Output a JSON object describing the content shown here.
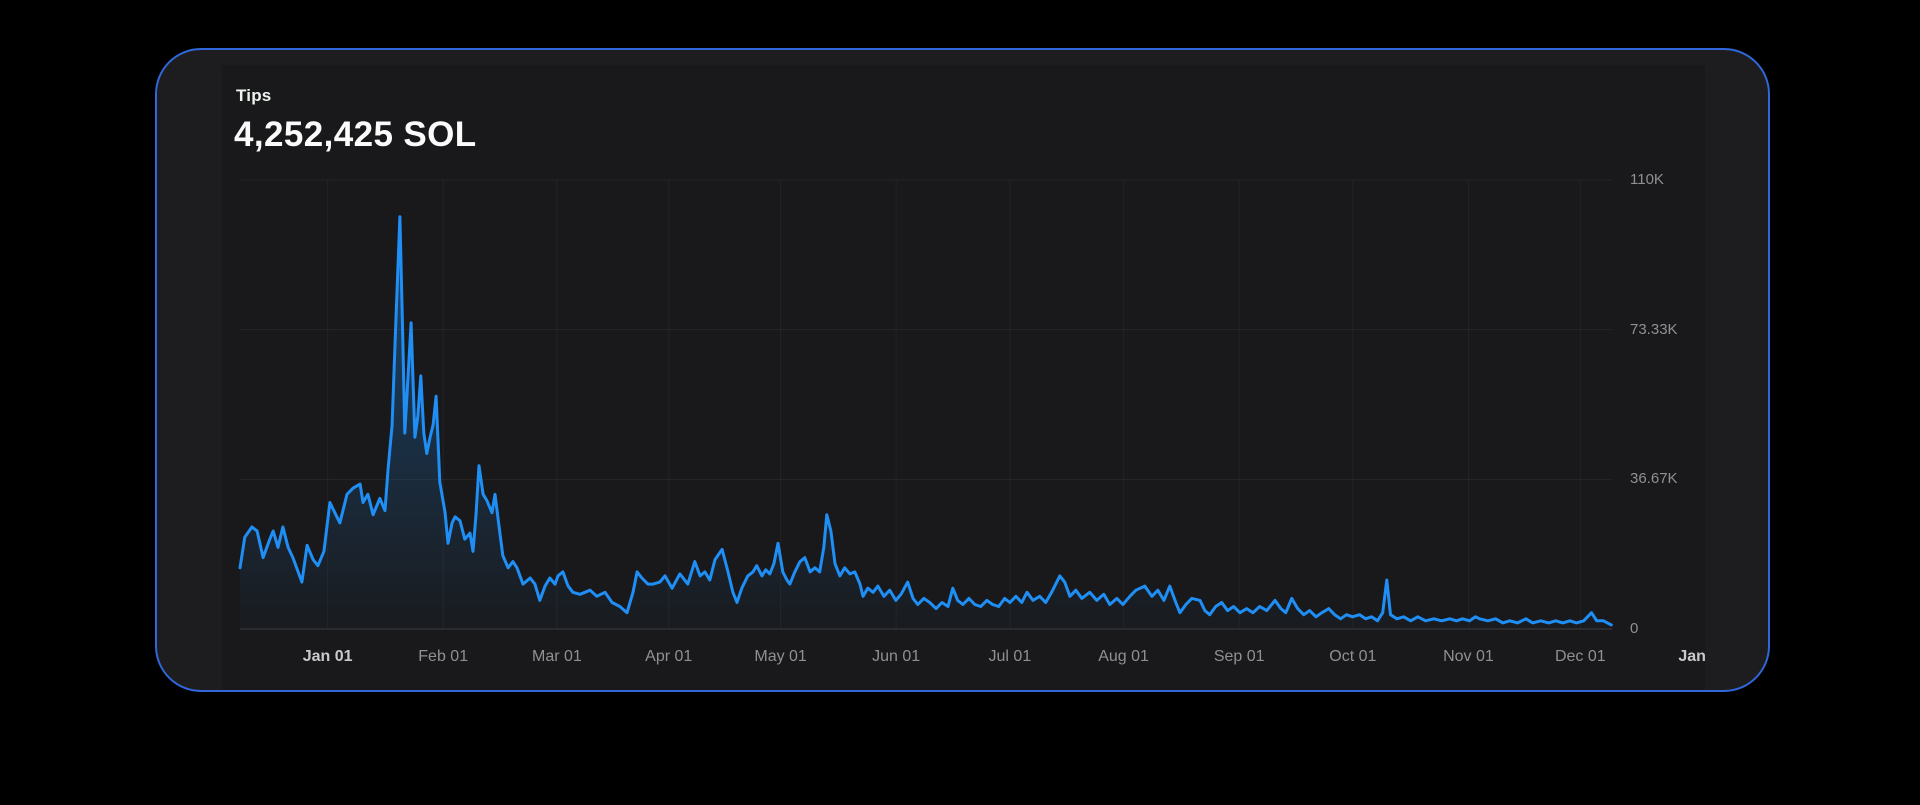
{
  "page": {
    "background_color": "#000000"
  },
  "card": {
    "border_color": "#3067da",
    "background": "#1d1d1f",
    "panel_background": "#19191b"
  },
  "header": {
    "title": "Tips",
    "value": "4,252,425 SOL"
  },
  "chart_data": {
    "type": "area",
    "title": "Tips",
    "total": "4,252,425 SOL",
    "unit": "SOL",
    "line_color": "#1f8ef5",
    "grid": true,
    "legend": null,
    "y_axis_position": "right",
    "ylim": [
      0,
      110000
    ],
    "y_ticks": [
      {
        "label": "0",
        "value": 0
      },
      {
        "label": "36.67K",
        "value": 36670
      },
      {
        "label": "73.33K",
        "value": 73330
      },
      {
        "label": "110K",
        "value": 110000
      }
    ],
    "x_unit": "days from series start (about Dec 08 of previous year)",
    "x_ticks": [
      {
        "label": "Jan 01",
        "d": 23.5,
        "emphasis": true
      },
      {
        "label": "Feb 01",
        "d": 54.5,
        "emphasis": false
      },
      {
        "label": "Mar 01",
        "d": 85.0,
        "emphasis": false
      },
      {
        "label": "Apr 01",
        "d": 115.0,
        "emphasis": false
      },
      {
        "label": "May 01",
        "d": 145.0,
        "emphasis": false
      },
      {
        "label": "Jun 01",
        "d": 176.0,
        "emphasis": false
      },
      {
        "label": "Jul 01",
        "d": 206.5,
        "emphasis": false
      },
      {
        "label": "Aug 01",
        "d": 237.0,
        "emphasis": false
      },
      {
        "label": "Sep 01",
        "d": 268.0,
        "emphasis": false
      },
      {
        "label": "Oct 01",
        "d": 298.5,
        "emphasis": false
      },
      {
        "label": "Nov 01",
        "d": 329.5,
        "emphasis": false
      },
      {
        "label": "Dec 01",
        "d": 359.5,
        "emphasis": false
      },
      {
        "label": "Jan",
        "d": 389.5,
        "emphasis": true
      }
    ],
    "points_value_unit": "thousand SOL per day",
    "points": [
      [
        0,
        15
      ],
      [
        1.3,
        22.5
      ],
      [
        3.2,
        25
      ],
      [
        4.6,
        24
      ],
      [
        6.2,
        17.5
      ],
      [
        8,
        22
      ],
      [
        8.9,
        24
      ],
      [
        10.2,
        20
      ],
      [
        11.5,
        25
      ],
      [
        12.9,
        20
      ],
      [
        14.2,
        17.5
      ],
      [
        16.6,
        11.5
      ],
      [
        18,
        20.5
      ],
      [
        19.6,
        17
      ],
      [
        20.9,
        15.5
      ],
      [
        22.5,
        19
      ],
      [
        24.1,
        31
      ],
      [
        25.7,
        28
      ],
      [
        26.8,
        26
      ],
      [
        28.7,
        33
      ],
      [
        30.3,
        34.5
      ],
      [
        32.2,
        35.5
      ],
      [
        33,
        31
      ],
      [
        34.3,
        33
      ],
      [
        35.7,
        28
      ],
      [
        37.5,
        32
      ],
      [
        38.9,
        29
      ],
      [
        39.7,
        39
      ],
      [
        40.8,
        50
      ],
      [
        41.8,
        75
      ],
      [
        42.9,
        101
      ],
      [
        43.7,
        70
      ],
      [
        44.2,
        48
      ],
      [
        45.9,
        75
      ],
      [
        46.9,
        47
      ],
      [
        47.7,
        52
      ],
      [
        48.5,
        62
      ],
      [
        49.3,
        48
      ],
      [
        50.1,
        43
      ],
      [
        51,
        47
      ],
      [
        51.8,
        50
      ],
      [
        52.6,
        57
      ],
      [
        53.6,
        36
      ],
      [
        55,
        28.5
      ],
      [
        55.8,
        21
      ],
      [
        56.9,
        26
      ],
      [
        57.7,
        27.5
      ],
      [
        59,
        26.5
      ],
      [
        60.3,
        22
      ],
      [
        61.7,
        23.5
      ],
      [
        62.5,
        19
      ],
      [
        63.3,
        28
      ],
      [
        64.1,
        40
      ],
      [
        65.2,
        33
      ],
      [
        66.2,
        31.5
      ],
      [
        67.6,
        28.5
      ],
      [
        68.4,
        33
      ],
      [
        69.7,
        23.5
      ],
      [
        70.5,
        18
      ],
      [
        71.9,
        15
      ],
      [
        73.2,
        16.5
      ],
      [
        74.3,
        15
      ],
      [
        75.9,
        11
      ],
      [
        77.8,
        12.5
      ],
      [
        79.1,
        11
      ],
      [
        80.4,
        7
      ],
      [
        81.8,
        10.5
      ],
      [
        83.1,
        12.5
      ],
      [
        84.5,
        11
      ],
      [
        85.3,
        13
      ],
      [
        86.6,
        14
      ],
      [
        88,
        10.5
      ],
      [
        89.3,
        9
      ],
      [
        91.2,
        8.5
      ],
      [
        93.9,
        9.5
      ],
      [
        95.7,
        8
      ],
      [
        97.9,
        9
      ],
      [
        99.8,
        6.5
      ],
      [
        101.9,
        5.5
      ],
      [
        103.8,
        4
      ],
      [
        105.4,
        9
      ],
      [
        106.5,
        14
      ],
      [
        107.8,
        12.5
      ],
      [
        109.4,
        11
      ],
      [
        110.8,
        11
      ],
      [
        112.6,
        11.5
      ],
      [
        114,
        13
      ],
      [
        115.9,
        10
      ],
      [
        118,
        13.5
      ],
      [
        120.1,
        11
      ],
      [
        122,
        16.5
      ],
      [
        123.4,
        13
      ],
      [
        124.7,
        14
      ],
      [
        126,
        12
      ],
      [
        127.4,
        17
      ],
      [
        129.3,
        19.5
      ],
      [
        130.9,
        14
      ],
      [
        132.2,
        9
      ],
      [
        133.3,
        6.5
      ],
      [
        134.6,
        10
      ],
      [
        136.2,
        13
      ],
      [
        137.6,
        14
      ],
      [
        138.6,
        15.5
      ],
      [
        140,
        13
      ],
      [
        141,
        14.5
      ],
      [
        142.1,
        13.5
      ],
      [
        143.2,
        16
      ],
      [
        144.3,
        21
      ],
      [
        145.6,
        14
      ],
      [
        146.7,
        12
      ],
      [
        147.5,
        11
      ],
      [
        148.8,
        14
      ],
      [
        150.2,
        16.5
      ],
      [
        151.5,
        17.5
      ],
      [
        152.9,
        14
      ],
      [
        154.2,
        15
      ],
      [
        155.5,
        14
      ],
      [
        156.6,
        20
      ],
      [
        157.4,
        28
      ],
      [
        158.5,
        24
      ],
      [
        159.6,
        16
      ],
      [
        160.9,
        13
      ],
      [
        162.2,
        15
      ],
      [
        163.6,
        13.5
      ],
      [
        164.9,
        14
      ],
      [
        166.3,
        11
      ],
      [
        167.1,
        8
      ],
      [
        168.4,
        10
      ],
      [
        169.8,
        9
      ],
      [
        171.1,
        10.5
      ],
      [
        172.7,
        8
      ],
      [
        174.3,
        9.5
      ],
      [
        175.9,
        7
      ],
      [
        177.3,
        8.5
      ],
      [
        179.1,
        11.5
      ],
      [
        180.5,
        7.5
      ],
      [
        181.8,
        6
      ],
      [
        183.4,
        7.5
      ],
      [
        185,
        6.5
      ],
      [
        186.7,
        5
      ],
      [
        188.3,
        6.5
      ],
      [
        189.9,
        5.5
      ],
      [
        191.2,
        10
      ],
      [
        192.5,
        7
      ],
      [
        193.9,
        6
      ],
      [
        195.5,
        7.5
      ],
      [
        197.1,
        6
      ],
      [
        198.7,
        5.5
      ],
      [
        200.3,
        7
      ],
      [
        201.9,
        6
      ],
      [
        203.5,
        5.5
      ],
      [
        205.1,
        7.5
      ],
      [
        206.5,
        6.5
      ],
      [
        208.1,
        8
      ],
      [
        209.7,
        6.5
      ],
      [
        211.1,
        9
      ],
      [
        212.7,
        7
      ],
      [
        214.5,
        8
      ],
      [
        216.1,
        6.5
      ],
      [
        217.7,
        9
      ],
      [
        219.9,
        13
      ],
      [
        221.2,
        11.5
      ],
      [
        222.6,
        8
      ],
      [
        224.2,
        9.5
      ],
      [
        225.8,
        7.5
      ],
      [
        227.9,
        9
      ],
      [
        229.8,
        7
      ],
      [
        231.7,
        8.5
      ],
      [
        233.3,
        6
      ],
      [
        235.2,
        7.5
      ],
      [
        236.8,
        6
      ],
      [
        238.7,
        8
      ],
      [
        240.3,
        9.5
      ],
      [
        242.7,
        10.5
      ],
      [
        244.6,
        8
      ],
      [
        246.2,
        9.5
      ],
      [
        247.8,
        7
      ],
      [
        249.4,
        10.5
      ],
      [
        251,
        6.5
      ],
      [
        252.1,
        4
      ],
      [
        253.7,
        6
      ],
      [
        255.3,
        7.5
      ],
      [
        257.5,
        7
      ],
      [
        258.8,
        4.5
      ],
      [
        260.1,
        3.5
      ],
      [
        261.7,
        5.5
      ],
      [
        263.3,
        6.5
      ],
      [
        264.9,
        4.5
      ],
      [
        266.5,
        5.5
      ],
      [
        268.2,
        4
      ],
      [
        270,
        5
      ],
      [
        271.7,
        4
      ],
      [
        273.5,
        5.5
      ],
      [
        275.4,
        4.5
      ],
      [
        277.6,
        7
      ],
      [
        279.2,
        5
      ],
      [
        280.5,
        4
      ],
      [
        282.1,
        7.5
      ],
      [
        283.7,
        5
      ],
      [
        285.3,
        3.5
      ],
      [
        286.9,
        4.5
      ],
      [
        288.6,
        3
      ],
      [
        290.2,
        4
      ],
      [
        292,
        5
      ],
      [
        293.6,
        3.5
      ],
      [
        295.2,
        2.5
      ],
      [
        296.8,
        3.5
      ],
      [
        298.4,
        3
      ],
      [
        300.3,
        3.5
      ],
      [
        301.9,
        2.5
      ],
      [
        303.5,
        3
      ],
      [
        305.1,
        2
      ],
      [
        306.5,
        4
      ],
      [
        307.6,
        12
      ],
      [
        308.6,
        3.5
      ],
      [
        310.3,
        2.5
      ],
      [
        312.1,
        3
      ],
      [
        314,
        2
      ],
      [
        315.9,
        3
      ],
      [
        318,
        2
      ],
      [
        320.2,
        2.5
      ],
      [
        322.3,
        2
      ],
      [
        324.5,
        2.5
      ],
      [
        326.3,
        2
      ],
      [
        327.9,
        2.5
      ],
      [
        329.8,
        2
      ],
      [
        331.4,
        3
      ],
      [
        332.5,
        2.5
      ],
      [
        334.7,
        2
      ],
      [
        336.8,
        2.5
      ],
      [
        338.7,
        1.5
      ],
      [
        340.6,
        2
      ],
      [
        342.7,
        1.5
      ],
      [
        344.9,
        2.5
      ],
      [
        346.7,
        1.5
      ],
      [
        348.9,
        2
      ],
      [
        351,
        1.5
      ],
      [
        352.9,
        2
      ],
      [
        354.8,
        1.5
      ],
      [
        356.7,
        2
      ],
      [
        358.5,
        1.5
      ],
      [
        360.4,
        2
      ],
      [
        362.5,
        4
      ],
      [
        363.9,
        2
      ],
      [
        365.7,
        2
      ],
      [
        367.8,
        1
      ]
    ]
  }
}
